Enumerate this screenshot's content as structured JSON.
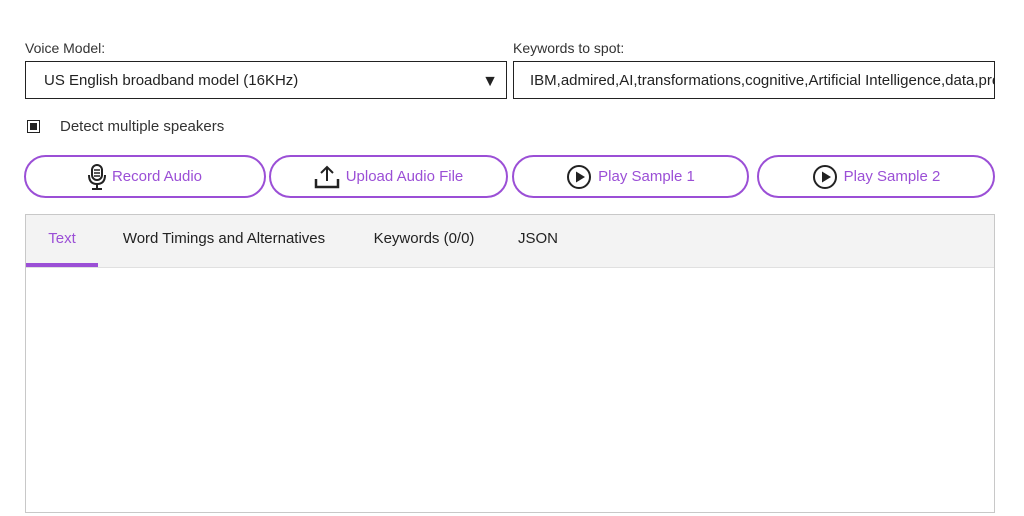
{
  "voice_model": {
    "label": "Voice Model:",
    "selected": "US English broadband model (16KHz)",
    "arrow": "▼"
  },
  "keywords": {
    "label": "Keywords to spot:",
    "value": "IBM,admired,AI,transformations,cognitive,Artificial Intelligence,data,predict,learn"
  },
  "detect_speakers": {
    "label": "Detect multiple speakers",
    "checked": true
  },
  "buttons": {
    "record": "Record Audio",
    "upload": "Upload Audio File",
    "sample1": "Play Sample 1",
    "sample2": "Play Sample 2"
  },
  "tabs": [
    {
      "label": "Text",
      "active": true
    },
    {
      "label": "Word Timings and Alternatives",
      "active": false
    },
    {
      "label": "Keywords (0/0)",
      "active": false
    },
    {
      "label": "JSON",
      "active": false
    }
  ],
  "colors": {
    "accent": "#9b4fd6",
    "tab_bar_bg": "#f3f3f3",
    "border": "#222222"
  },
  "icons": {
    "record": "microphone-icon",
    "upload": "upload-icon",
    "play": "play-circle-icon"
  }
}
